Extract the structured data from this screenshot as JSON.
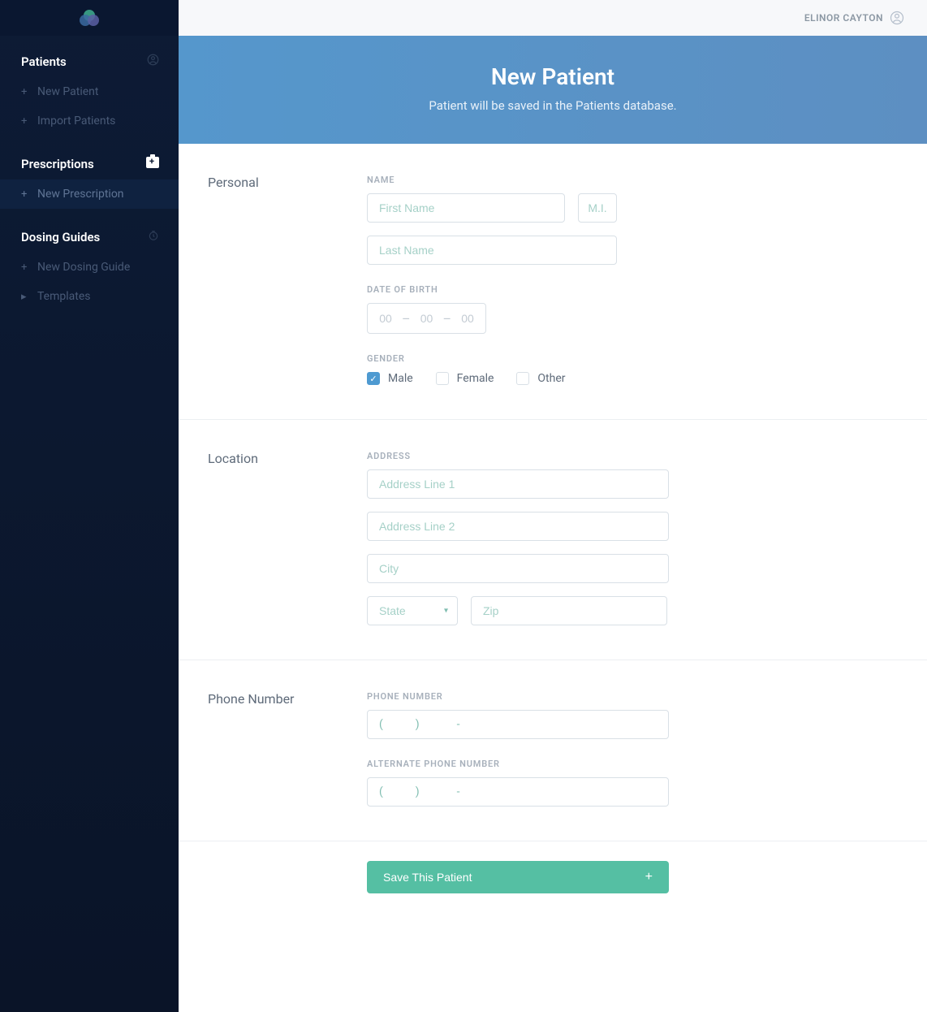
{
  "topbar": {
    "username": "ELINOR CAYTON"
  },
  "sidebar": {
    "sections": [
      {
        "heading": "Patients",
        "items": [
          {
            "label": "New Patient"
          },
          {
            "label": "Import Patients"
          }
        ]
      },
      {
        "heading": "Prescriptions",
        "items": [
          {
            "label": "New Prescription"
          }
        ]
      },
      {
        "heading": "Dosing Guides",
        "items": [
          {
            "label": "New Dosing Guide"
          },
          {
            "label": "Templates"
          }
        ]
      }
    ]
  },
  "hero": {
    "title": "New Patient",
    "subtitle": "Patient will be saved in the Patients database."
  },
  "form": {
    "personal": {
      "section_label": "Personal",
      "name_label": "NAME",
      "first_name_placeholder": "First Name",
      "mi_placeholder": "M.I.",
      "last_name_placeholder": "Last Name",
      "dob_label": "DATE OF BIRTH",
      "dob_placeholder": "00",
      "gender_label": "GENDER",
      "gender_options": {
        "male": "Male",
        "female": "Female",
        "other": "Other"
      },
      "gender_selected": "male"
    },
    "location": {
      "section_label": "Location",
      "address_label": "ADDRESS",
      "addr1_placeholder": "Address Line 1",
      "addr2_placeholder": "Address Line 2",
      "city_placeholder": "City",
      "state_placeholder": "State",
      "zip_placeholder": "Zip"
    },
    "phone": {
      "section_label": "Phone Number",
      "primary_label": "PHONE NUMBER",
      "alternate_label": "ALTERNATE PHONE NUMBER"
    },
    "submit_label": "Save This Patient"
  }
}
